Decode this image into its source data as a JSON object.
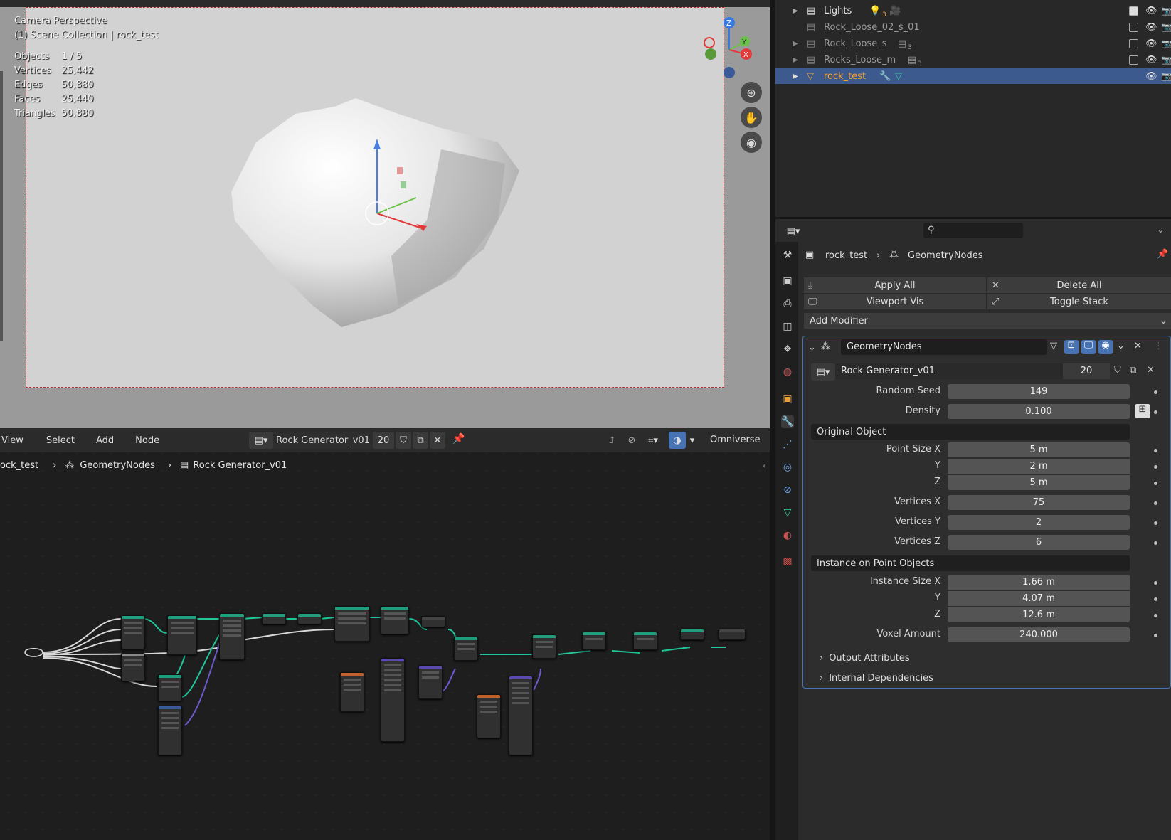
{
  "viewport": {
    "perspective": "Camera Perspective",
    "collection": "(1) Scene Collection | rock_test",
    "stats": [
      {
        "label": "Objects",
        "value": "1 / 5"
      },
      {
        "label": "Vertices",
        "value": "25,442"
      },
      {
        "label": "Edges",
        "value": "50,880"
      },
      {
        "label": "Faces",
        "value": "25,440"
      },
      {
        "label": "Triangles",
        "value": "50,880"
      }
    ],
    "axes": {
      "z": "Z",
      "y": "Y",
      "x": "X"
    }
  },
  "node_editor": {
    "menu": [
      "View",
      "Select",
      "Add",
      "Node"
    ],
    "tree_name": "Rock Generator_v01",
    "users": "20",
    "right_label": "Omniverse",
    "breadcrumb": {
      "object": "ock_test",
      "modifier": "GeometryNodes",
      "tree": "Rock Generator_v01",
      "tree_users": "20"
    }
  },
  "outliner": {
    "rows": [
      {
        "name": "Lights",
        "badge": "3",
        "dim": false,
        "selected": false
      },
      {
        "name": "Rock_Loose_02_s_01",
        "badge": "",
        "dim": true,
        "selected": false
      },
      {
        "name": "Rock_Loose_s",
        "badge": "3",
        "dim": true,
        "selected": false
      },
      {
        "name": "Rocks_Loose_m",
        "badge": "3",
        "dim": true,
        "selected": false
      },
      {
        "name": "rock_test",
        "badge": "",
        "dim": false,
        "selected": true
      }
    ]
  },
  "properties": {
    "breadcrumb_object": "rock_test",
    "breadcrumb_modifier": "GeometryNodes",
    "apply_all": "Apply All",
    "delete_all": "Delete All",
    "viewport_vis": "Viewport Vis",
    "toggle_stack": "Toggle Stack",
    "add_modifier": "Add Modifier",
    "modifier_name": "GeometryNodes",
    "node_group": "Rock Generator_v01",
    "node_group_users": "20",
    "fields": {
      "random_seed": {
        "label": "Random Seed",
        "value": "149"
      },
      "density": {
        "label": "Density",
        "value": "0.100"
      },
      "point_size_x": {
        "label": "Point Size X",
        "value": "5 m"
      },
      "point_size_y": {
        "label": "Y",
        "value": "2 m"
      },
      "point_size_z": {
        "label": "Z",
        "value": "5 m"
      },
      "vertices_x": {
        "label": "Vertices X",
        "value": "75"
      },
      "vertices_y": {
        "label": "Vertices Y",
        "value": "2"
      },
      "vertices_z": {
        "label": "Vertices Z",
        "value": "6"
      },
      "instance_size_x": {
        "label": "Instance Size X",
        "value": "1.66 m"
      },
      "instance_size_y": {
        "label": "Y",
        "value": "4.07 m"
      },
      "instance_size_z": {
        "label": "Z",
        "value": "12.6 m"
      },
      "voxel_amount": {
        "label": "Voxel Amount",
        "value": "240.000"
      }
    },
    "section_original_object": "Original Object",
    "section_instance": "Instance on Point Objects",
    "output_attributes": "Output Attributes",
    "internal_dependencies": "Internal Dependencies"
  },
  "colors": {
    "accent_selection": "#3d5a8f",
    "node_link": "#1fc79a",
    "axis_x": "#e03a3a",
    "axis_y": "#6ac24a",
    "axis_z": "#3a7ae0"
  }
}
